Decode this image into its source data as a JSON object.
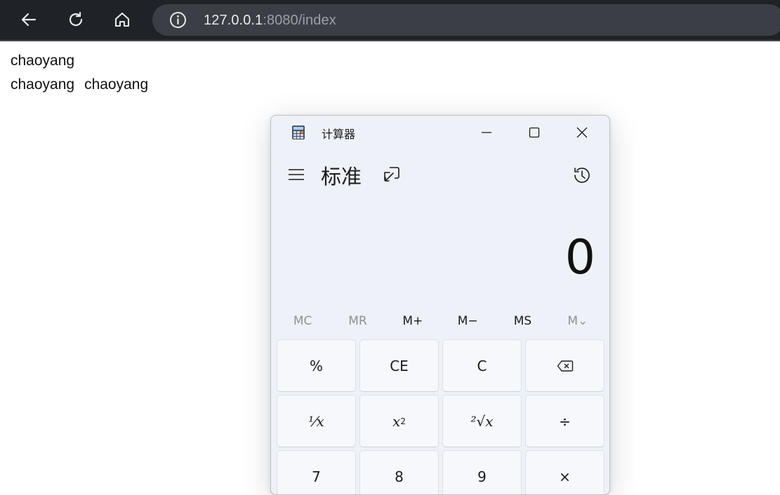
{
  "browser": {
    "url_host": "127.0.0.1",
    "url_rest": ":8080/index"
  },
  "page": {
    "line1": "chaoyang",
    "line2": [
      "chaoyang",
      "chaoyang"
    ]
  },
  "calculator": {
    "title": "计算器",
    "mode": "标准",
    "display": "0",
    "memory": [
      {
        "label": "MC",
        "enabled": false
      },
      {
        "label": "MR",
        "enabled": false
      },
      {
        "label": "M+",
        "enabled": true
      },
      {
        "label": "M−",
        "enabled": true
      },
      {
        "label": "MS",
        "enabled": true
      },
      {
        "label": "M⌄",
        "enabled": false
      }
    ],
    "keys": {
      "percent": "%",
      "clear_entry": "CE",
      "clear": "C",
      "reciprocal": "⅟x",
      "square_base": "x",
      "square_exp": "2",
      "sqrt": "²√x",
      "divide": "÷",
      "seven": "7",
      "eight": "8",
      "nine": "9",
      "multiply": "×"
    }
  }
}
